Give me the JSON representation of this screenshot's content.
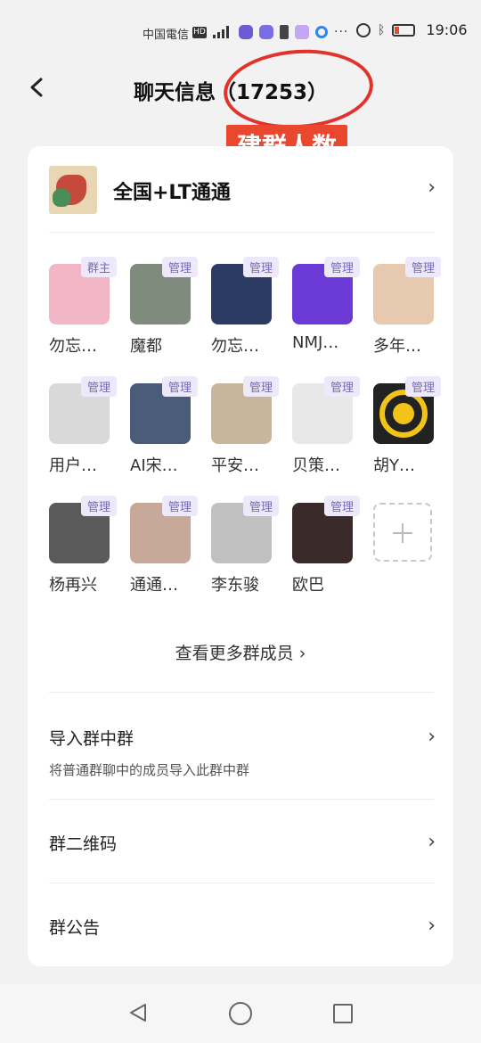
{
  "status": {
    "carrier": "中国電信",
    "hd": "HD",
    "time": "19:06",
    "battery_level": 0.2
  },
  "header": {
    "title": "聊天信息（17253）",
    "annotation": "建群人数"
  },
  "group": {
    "name": "全国+LT通通"
  },
  "members": [
    {
      "name": "勿忘…",
      "role": "群主",
      "color": "#f3b6c7"
    },
    {
      "name": "魔都",
      "role": "管理",
      "color": "#7f8b7c"
    },
    {
      "name": "勿忘…",
      "role": "管理",
      "color": "#2c3b63"
    },
    {
      "name": "NMJ…",
      "role": "管理",
      "color": "#6b3ad6"
    },
    {
      "name": "多年…",
      "role": "管理",
      "color": "#e7c9b0"
    },
    {
      "name": "用户…",
      "role": "管理",
      "color": "#d9d9d9"
    },
    {
      "name": "AI宋…",
      "role": "管理",
      "color": "#4b5b7a"
    },
    {
      "name": "平安…",
      "role": "管理",
      "color": "#c9b59a"
    },
    {
      "name": "贝策…",
      "role": "管理",
      "color": "#e8e8e8"
    },
    {
      "name": "胡Y…",
      "role": "管理",
      "color": "#222222"
    },
    {
      "name": "杨再兴",
      "role": "管理",
      "color": "#5a5a5a"
    },
    {
      "name": "通通…",
      "role": "管理",
      "color": "#c7a999"
    },
    {
      "name": "李东骏",
      "role": "管理",
      "color": "#c0c0c0"
    },
    {
      "name": "欧巴",
      "role": "管理",
      "color": "#3a2a2a"
    }
  ],
  "see_more": "查看更多群成员 ›",
  "rows": [
    {
      "title": "导入群中群",
      "subtitle": "将普通群聊中的成员导入此群中群"
    },
    {
      "title": "群二维码"
    },
    {
      "title": "群公告"
    }
  ]
}
